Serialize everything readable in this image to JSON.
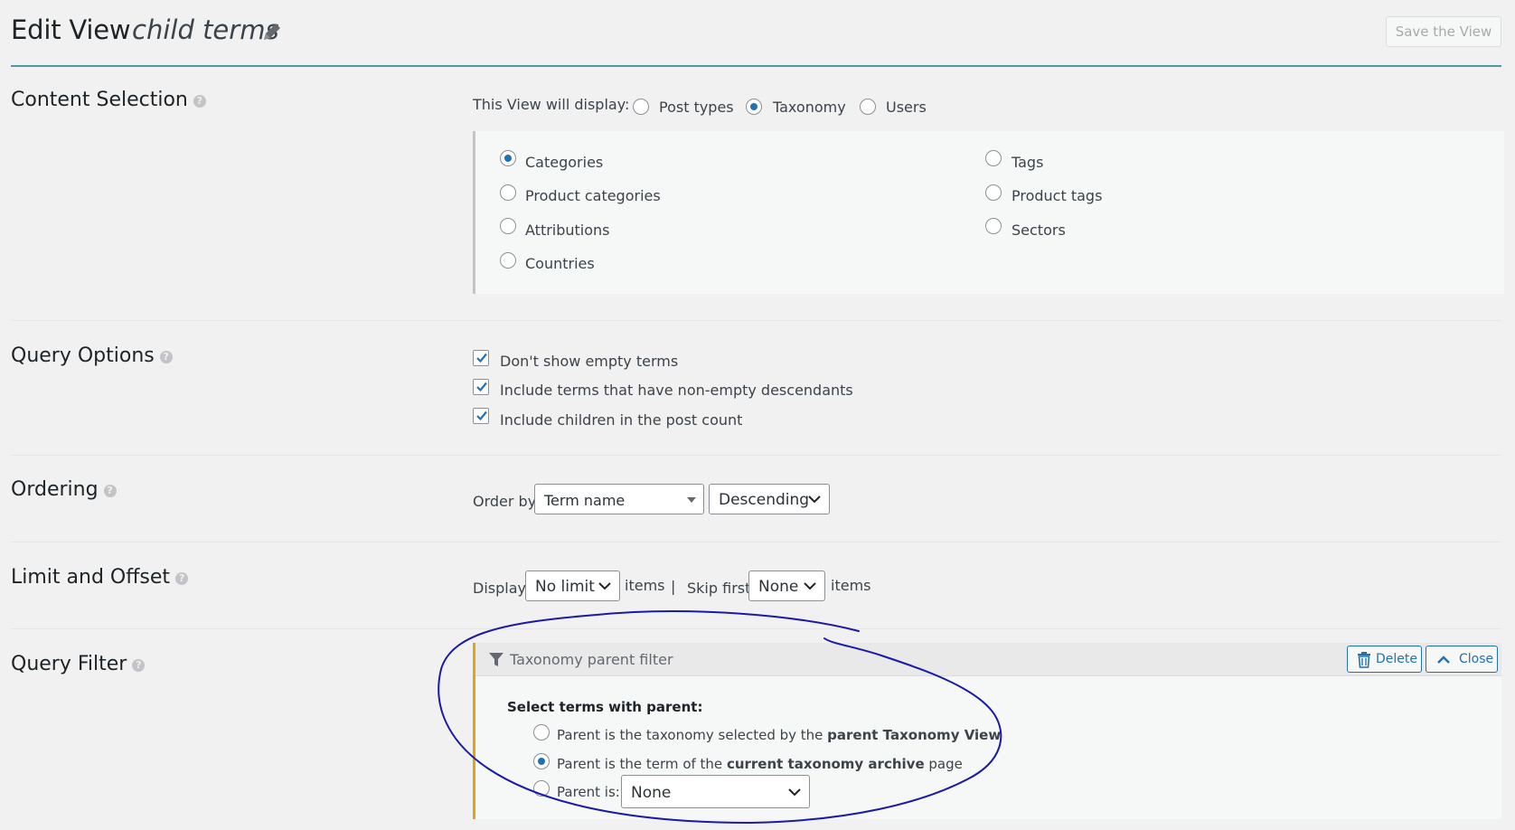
{
  "header": {
    "title": "Edit View",
    "view_name": "child terms",
    "save_label": "Save the View"
  },
  "content_selection": {
    "label": "Content Selection",
    "display_label": "This View will display:",
    "display_options": [
      "Post types",
      "Taxonomy",
      "Users"
    ],
    "display_selected": "Taxonomy",
    "taxonomies_left": [
      "Categories",
      "Product categories",
      "Attributions",
      "Countries"
    ],
    "taxonomies_right": [
      "Tags",
      "Product tags",
      "Sectors"
    ],
    "taxonomy_selected": "Categories"
  },
  "query_options": {
    "label": "Query Options",
    "checkboxes": [
      "Don't show empty terms",
      "Include terms that have non-empty descendants",
      "Include children in the post count"
    ]
  },
  "ordering": {
    "label": "Ordering",
    "order_by_label": "Order by",
    "order_field": "Term name",
    "order_direction": "Descending"
  },
  "limit_offset": {
    "label": "Limit and Offset",
    "display_label": "Display",
    "limit_value": "No limit",
    "items_label": "items",
    "separator": "|",
    "skip_label": "Skip first",
    "skip_value": "None",
    "items_label_2": "items"
  },
  "query_filter": {
    "label": "Query Filter",
    "panel_title": "Taxonomy parent filter",
    "delete_label": "Delete",
    "close_label": "Close",
    "heading": "Select terms with parent:",
    "option1_pre": "Parent is the taxonomy selected by the ",
    "option1_bold": "parent Taxonomy View",
    "option2_pre": "Parent is the term of the ",
    "option2_bold": "current taxonomy archive",
    "option2_post": " page",
    "option3_label": "Parent is:",
    "parent_select_value": "None",
    "selected_option": 2
  },
  "colors": {
    "accent": "#2271b1",
    "header_rule": "#4d9ba0",
    "filter_border": "#dba617",
    "annotation_ink": "#1a1aa6"
  },
  "icons": {
    "edit": "pencil-icon",
    "help": "question-mark-icon",
    "filter": "funnel-icon",
    "delete": "trash-icon",
    "close": "chevron-up-icon"
  }
}
